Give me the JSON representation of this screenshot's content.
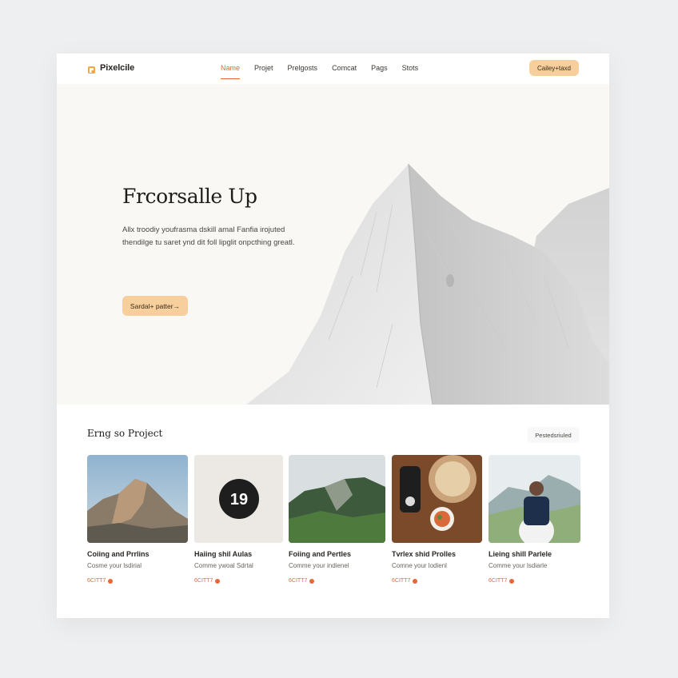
{
  "brand": {
    "name": "Pixelcile"
  },
  "nav": {
    "items": [
      {
        "label": "Name",
        "active": true
      },
      {
        "label": "Projet",
        "active": false
      },
      {
        "label": "Prelgosts",
        "active": false
      },
      {
        "label": "Comcat",
        "active": false
      },
      {
        "label": "Pags",
        "active": false
      },
      {
        "label": "Stots",
        "active": false
      }
    ],
    "cta_label": "Cailey+taxd"
  },
  "hero": {
    "title": "Frcorsalle Up",
    "description": "Allx troodiy youfrasma dskill amal Fanfia irojuted thendilge tu saret ynd dit foll lipglit onpcthing greatl.",
    "button_label": "Sardal+ patter→"
  },
  "projects": {
    "title": "Erng so Project",
    "link_label": "Pestedsriuled",
    "cards": [
      {
        "title": "Coiing and Prrlins",
        "subtitle": "Cosme your lsdirial",
        "meta": "6CITT7"
      },
      {
        "title": "Haiing shil Aulas",
        "subtitle": "Comme ywoal Sdrtal",
        "meta": "6CITT7",
        "badge": "19"
      },
      {
        "title": "Foiing and Pertles",
        "subtitle": "Comme your indienel",
        "meta": "6CITT7"
      },
      {
        "title": "Tvrlex shid Prolles",
        "subtitle": "Comne your lodienl",
        "meta": "6CITT7"
      },
      {
        "title": "Lieing shill Parlele",
        "subtitle": "Comme your lsdiarle",
        "meta": "6CITT7"
      }
    ]
  },
  "colors": {
    "accent": "#e2683c",
    "button": "#f6cf9c",
    "hero_bg": "#faf8f5",
    "page_bg": "#eeeff1"
  }
}
